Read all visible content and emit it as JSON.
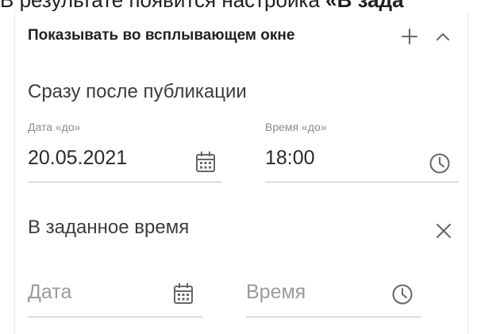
{
  "page_header": {
    "text_left": "В результате появится настройка ",
    "text_bold": "«В зада"
  },
  "panel": {
    "title": "Показывать во всплывающем окне",
    "add_icon": "plus-icon",
    "collapse_icon": "chevron-up-icon"
  },
  "immediate": {
    "title": "Сразу после публикации",
    "date": {
      "label": "Дата «до»",
      "value": "20.05.2021",
      "icon": "calendar-icon"
    },
    "time": {
      "label": "Время «до»",
      "value": "18:00",
      "icon": "clock-icon"
    }
  },
  "scheduled": {
    "title": "В заданное время",
    "remove_icon": "close-icon",
    "date": {
      "placeholder": "Дата",
      "icon": "calendar-icon"
    },
    "time": {
      "placeholder": "Время",
      "icon": "clock-icon"
    }
  },
  "colors": {
    "text": "#212121",
    "label": "#8a8a8a",
    "placeholder": "#9a9a9a",
    "underline": "#bdbdbd"
  }
}
